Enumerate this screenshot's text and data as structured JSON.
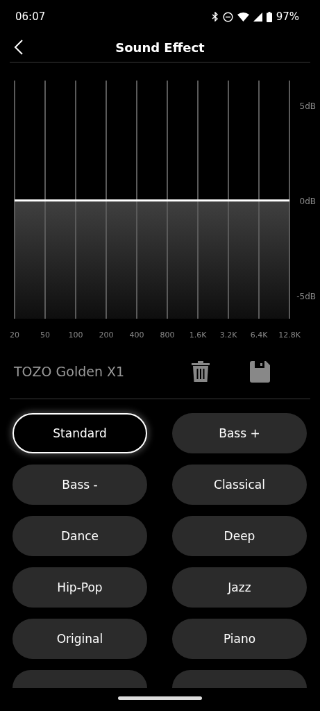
{
  "status_bar": {
    "time": "06:07",
    "battery": "97%"
  },
  "header": {
    "title": "Sound Effect"
  },
  "equalizer": {
    "chart_data": {
      "type": "line",
      "categories": [
        "20",
        "50",
        "100",
        "200",
        "400",
        "800",
        "1.6K",
        "3.2K",
        "6.4K",
        "12.8K"
      ],
      "series": [
        {
          "color": "#ffffff",
          "values": [
            0,
            0,
            0,
            0,
            0,
            0,
            0,
            0,
            0,
            0
          ]
        }
      ],
      "ylim": [
        -6.2,
        6.3
      ],
      "yticks": [
        {
          "value": 5,
          "label": "5dB"
        },
        {
          "value": 0,
          "label": "0dB"
        },
        {
          "value": -5,
          "label": "-5dB"
        }
      ]
    }
  },
  "device": {
    "name": "TOZO Golden X1"
  },
  "presets": [
    {
      "kind": "full",
      "label": "Standard",
      "selected": true
    },
    {
      "kind": "full",
      "label": "Bass +",
      "selected": false
    },
    {
      "kind": "full",
      "label": "Bass -",
      "selected": false
    },
    {
      "kind": "full",
      "label": "Classical",
      "selected": false
    },
    {
      "kind": "full",
      "label": "Dance",
      "selected": false
    },
    {
      "kind": "full",
      "label": "Deep",
      "selected": false
    },
    {
      "kind": "full",
      "label": "Hip-Pop",
      "selected": false
    },
    {
      "kind": "full",
      "label": "Jazz",
      "selected": false
    },
    {
      "kind": "full",
      "label": "Original",
      "selected": false
    },
    {
      "kind": "full",
      "label": "Piano",
      "selected": false
    },
    {
      "kind": "cut",
      "selected": false
    },
    {
      "kind": "cut",
      "selected": false
    }
  ]
}
